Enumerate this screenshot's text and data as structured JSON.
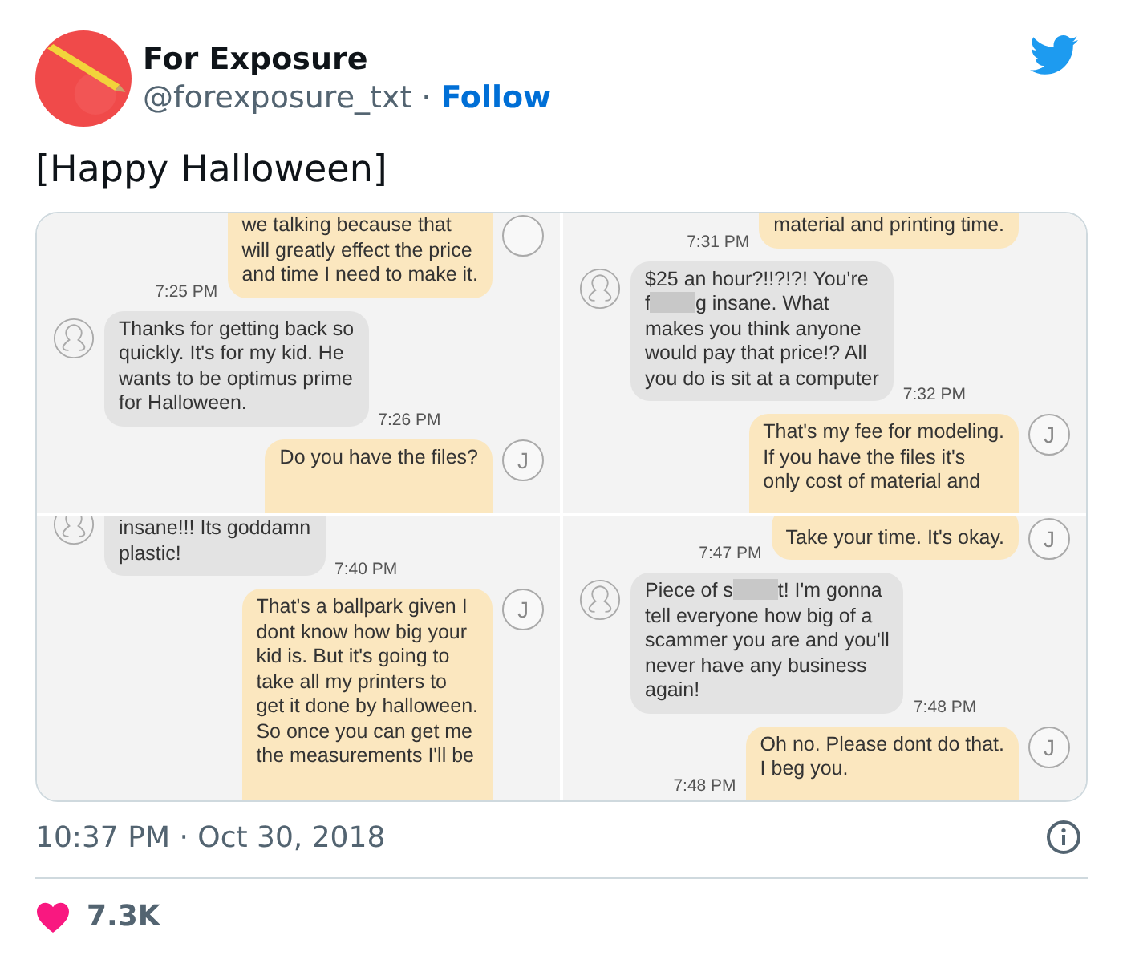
{
  "tweet": {
    "author": {
      "name": "For Exposure",
      "handle": "@forexposure_txt",
      "separator": "·",
      "follow": "Follow"
    },
    "text": "[Happy Halloween]",
    "media": {
      "panels": [
        {
          "messages": [
            {
              "kind": "outgoing",
              "avatar": true,
              "time": "7:25 PM",
              "parts": [
                {
                  "kind": "text",
                  "text": "we talking because that\nwill greatly effect the price\nand time I need to make it."
                }
              ]
            },
            {
              "kind": "incoming",
              "avatar": true,
              "time": "7:26 PM",
              "parts": [
                {
                  "kind": "text",
                  "text": "Thanks for getting back so\nquickly. It's for my kid. He\nwants to be optimus prime\nfor Halloween."
                }
              ]
            },
            {
              "kind": "outgoing",
              "avatar": true,
              "initial": "J",
              "parts": [
                {
                  "kind": "text",
                  "text": "Do you have the files?"
                }
              ]
            }
          ]
        },
        {
          "messages": [
            {
              "kind": "outgoing",
              "avatar": false,
              "time": "7:31 PM",
              "parts": [
                {
                  "kind": "text",
                  "text": "material and printing time."
                }
              ]
            },
            {
              "kind": "incoming",
              "avatar": true,
              "time": "7:32 PM",
              "parts": [
                {
                  "kind": "text",
                  "text": "$25 an hour?!!?!?! You're\nf"
                },
                {
                  "kind": "blur"
                },
                {
                  "kind": "text",
                  "text": "g insane. What\nmakes you think anyone\nwould pay that price!? All\nyou do is sit at a computer"
                }
              ]
            },
            {
              "kind": "outgoing",
              "avatar": true,
              "initial": "J",
              "parts": [
                {
                  "kind": "text",
                  "text": "That's my fee for modeling.\nIf you have the files it's\nonly cost of material and"
                }
              ]
            }
          ]
        },
        {
          "messages": [
            {
              "kind": "incoming",
              "avatar": true,
              "time": "7:40 PM",
              "parts": [
                {
                  "kind": "text",
                  "text": "insane!!! Its goddamn\nplastic!"
                }
              ]
            },
            {
              "kind": "outgoing",
              "avatar": true,
              "initial": "J",
              "parts": [
                {
                  "kind": "text",
                  "text": "That's a ballpark given I\ndont know how big your\nkid is. But it's going to\ntake all my printers to\nget it done by halloween.\nSo once you can get me\nthe measurements I'll be"
                }
              ]
            }
          ]
        },
        {
          "messages": [
            {
              "kind": "outgoing",
              "avatar": true,
              "initial": "J",
              "time": "7:47 PM",
              "parts": [
                {
                  "kind": "text",
                  "text": "Take your time. It's okay."
                }
              ]
            },
            {
              "kind": "incoming",
              "avatar": true,
              "time": "7:48 PM",
              "parts": [
                {
                  "kind": "text",
                  "text": "Piece of s"
                },
                {
                  "kind": "blur"
                },
                {
                  "kind": "text",
                  "text": "t! I'm gonna\ntell everyone how big of a\nscammer you are and you'll\nnever have any business\nagain!"
                }
              ]
            },
            {
              "kind": "outgoing",
              "avatar": true,
              "initial": "J",
              "time": "7:48 PM",
              "parts": [
                {
                  "kind": "text",
                  "text": "Oh no. Please dont do that.\nI beg you."
                }
              ]
            }
          ]
        }
      ]
    },
    "timestamp": "10:37 PM · Oct 30, 2018",
    "likes": "7.3K"
  }
}
